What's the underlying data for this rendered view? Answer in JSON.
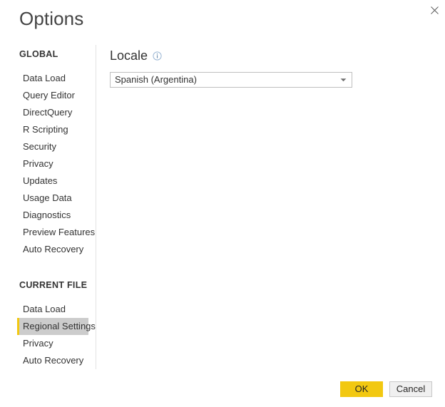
{
  "window": {
    "title": "Options",
    "close_icon": "close-icon"
  },
  "sidebar": {
    "sections": [
      {
        "heading": "GLOBAL",
        "items": [
          {
            "label": "Data Load",
            "selected": false
          },
          {
            "label": "Query Editor",
            "selected": false
          },
          {
            "label": "DirectQuery",
            "selected": false
          },
          {
            "label": "R Scripting",
            "selected": false
          },
          {
            "label": "Security",
            "selected": false
          },
          {
            "label": "Privacy",
            "selected": false
          },
          {
            "label": "Updates",
            "selected": false
          },
          {
            "label": "Usage Data",
            "selected": false
          },
          {
            "label": "Diagnostics",
            "selected": false
          },
          {
            "label": "Preview Features",
            "selected": false
          },
          {
            "label": "Auto Recovery",
            "selected": false
          }
        ]
      },
      {
        "heading": "CURRENT FILE",
        "items": [
          {
            "label": "Data Load",
            "selected": false
          },
          {
            "label": "Regional Settings",
            "selected": true
          },
          {
            "label": "Privacy",
            "selected": false
          },
          {
            "label": "Auto Recovery",
            "selected": false
          }
        ]
      }
    ]
  },
  "content": {
    "locale": {
      "label": "Locale",
      "info_icon": "info-icon",
      "selected_value": "Spanish (Argentina)",
      "caret_icon": "chevron-down-icon"
    }
  },
  "footer": {
    "ok_label": "OK",
    "cancel_label": "Cancel"
  },
  "colors": {
    "accent": "#f2c811",
    "selected_row_bg": "#cccccc",
    "text": "#333333",
    "border": "#bfbfbf",
    "divider": "#e2e2e2",
    "cancel_bg": "#f0f0f0"
  }
}
